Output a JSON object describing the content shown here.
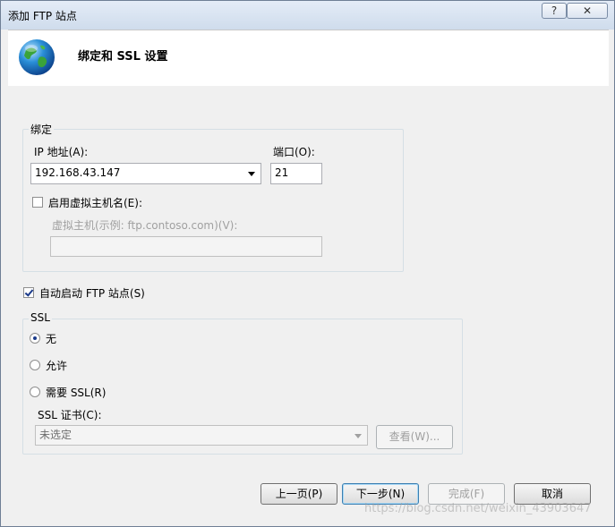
{
  "window": {
    "title": "添加 FTP 站点",
    "help_label": "?",
    "close_label": "✕"
  },
  "header": {
    "title": "绑定和 SSL 设置",
    "icon": "globe-icon"
  },
  "binding": {
    "group_label": "绑定",
    "ip_label": "IP 地址(A):",
    "ip_value": "192.168.43.147",
    "port_label": "端口(O):",
    "port_value": "21",
    "virtual_host_checkbox_label": "启用虚拟主机名(E):",
    "virtual_host_checked": false,
    "virtual_host_field_label": "虚拟主机(示例: ftp.contoso.com)(V):",
    "virtual_host_value": ""
  },
  "auto_start": {
    "label": "自动启动 FTP 站点(S)",
    "checked": true
  },
  "ssl": {
    "group_label": "SSL",
    "options": [
      {
        "label": "无",
        "selected": true
      },
      {
        "label": "允许",
        "selected": false
      },
      {
        "label": "需要 SSL(R)",
        "selected": false
      }
    ],
    "cert_label": "SSL 证书(C):",
    "cert_value": "未选定",
    "view_button": "查看(W)..."
  },
  "footer": {
    "prev_button": "上一页(P)",
    "next_button": "下一步(N)",
    "finish_button": "完成(F)",
    "cancel_button": "取消"
  },
  "watermark": "https://blog.csdn.net/weixin_43903647"
}
